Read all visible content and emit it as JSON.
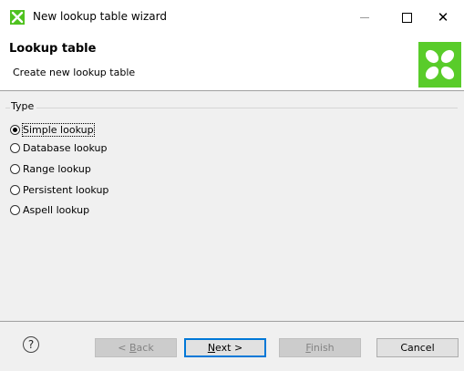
{
  "window": {
    "title": "New lookup table wizard",
    "icon": "cloverdx-logo-icon",
    "minimize_icon": "minimize-icon",
    "maximize_icon": "maximize-icon",
    "close_icon": "close-icon",
    "close_glyph": "✕"
  },
  "header": {
    "title": "Lookup table",
    "description": "Create new lookup table",
    "logo": "cloverdx-logo-icon"
  },
  "group": {
    "label": "Type",
    "options": [
      {
        "label": "Simple lookup",
        "checked": true
      },
      {
        "label": "Database lookup",
        "checked": false
      },
      {
        "label": "Range lookup",
        "checked": false
      },
      {
        "label": "Persistent lookup",
        "checked": false
      },
      {
        "label": "Aspell lookup",
        "checked": false
      }
    ]
  },
  "footer": {
    "help_glyph": "?",
    "back": {
      "prefix": "< ",
      "mnemonic": "B",
      "rest": "ack",
      "enabled": false
    },
    "next": {
      "mnemonic": "N",
      "rest": "ext >",
      "enabled": true
    },
    "finish": {
      "mnemonic": "F",
      "rest": "inish",
      "enabled": false
    },
    "cancel": {
      "label": "Cancel",
      "enabled": true
    }
  },
  "colors": {
    "accent_green": "#59cc2a",
    "focus_blue": "#0078d7",
    "dialog_bg": "#f0f0f0"
  }
}
